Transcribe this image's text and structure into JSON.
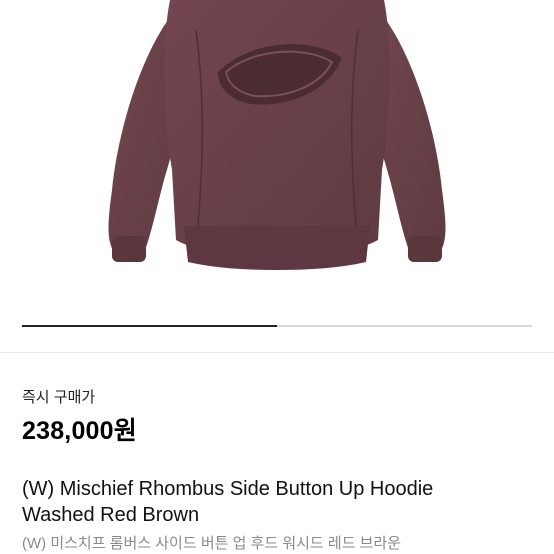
{
  "product": {
    "image_alt": "washed red brown hoodie",
    "carousel_progress": 0.5,
    "purchase_label": "즉시 구매가",
    "price": "238,000원",
    "title_line1": "(W) Mischief Rhombus Side Button Up Hoodie",
    "title_line2": "Washed Red Brown",
    "subtitle": "(W) 미스치프 롬버스 사이드 버튼 업 후드 워시드 레드 브라운"
  },
  "colors": {
    "garment": "#6b4149",
    "progress_fill": "#222222",
    "subtitle": "#8a8a8a"
  }
}
